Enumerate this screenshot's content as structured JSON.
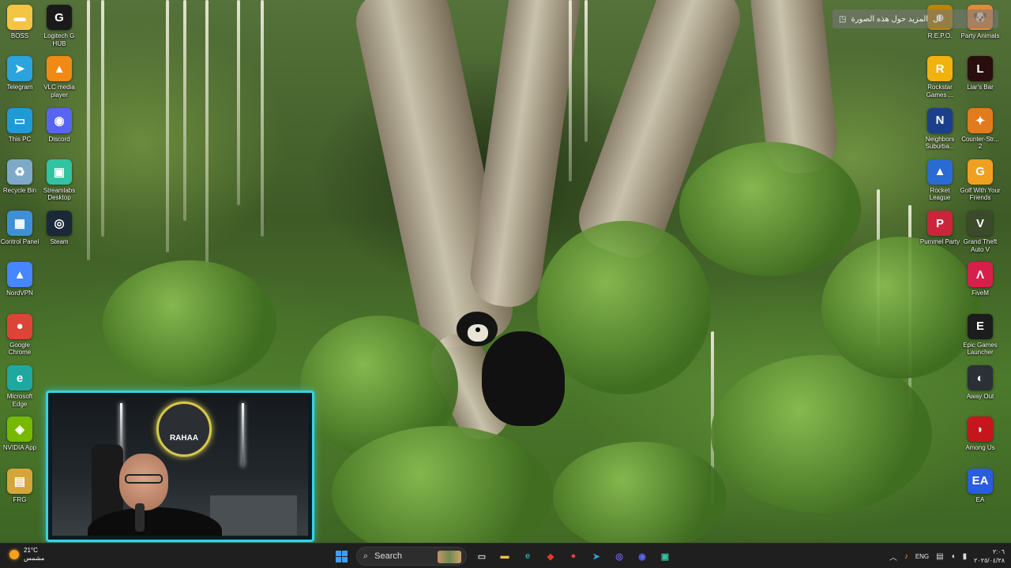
{
  "wallpaper": {
    "subject": "spectacled bear in forest tree"
  },
  "learn_pill": {
    "text": "المزيد حول هذه الصورة",
    "prefix": "ال"
  },
  "desktop_icons_left": [
    {
      "label": "BOSS",
      "icon": "folder-icon",
      "color": "#f4c542",
      "glyph": "▬"
    },
    {
      "label": "Logitech G HUB",
      "icon": "logitech-g-icon",
      "color": "#1a1a1a",
      "glyph": "G"
    },
    {
      "label": "Telegram",
      "icon": "telegram-icon",
      "color": "#2aa3df",
      "glyph": "➤"
    },
    {
      "label": "VLC media player",
      "icon": "vlc-icon",
      "color": "#f08a14",
      "glyph": "▲"
    },
    {
      "label": "This PC",
      "icon": "monitor-icon",
      "color": "#1e9bd7",
      "glyph": "▭"
    },
    {
      "label": "Discord",
      "icon": "discord-icon",
      "color": "#5865f2",
      "glyph": "◉"
    },
    {
      "label": "Recycle Bin",
      "icon": "recycle-bin-icon",
      "color": "#7fa9c9",
      "glyph": "♻"
    },
    {
      "label": "Streamlabs Desktop",
      "icon": "streamlabs-icon",
      "color": "#31c3a2",
      "glyph": "▣"
    },
    {
      "label": "Control Panel",
      "icon": "control-panel-icon",
      "color": "#3f8fd8",
      "glyph": "▦"
    },
    {
      "label": "Steam",
      "icon": "steam-icon",
      "color": "#1b2838",
      "glyph": "◎"
    },
    {
      "label": "NordVPN",
      "icon": "nordvpn-icon",
      "color": "#4687ff",
      "glyph": "▲"
    },
    {
      "label": "",
      "icon": "",
      "color": "",
      "glyph": ""
    },
    {
      "label": "Google Chrome",
      "icon": "chrome-icon",
      "color": "#db4437",
      "glyph": "●"
    },
    {
      "label": "",
      "icon": "",
      "color": "",
      "glyph": ""
    },
    {
      "label": "Microsoft Edge",
      "icon": "edge-icon",
      "color": "#1fa8a0",
      "glyph": "e"
    },
    {
      "label": "",
      "icon": "",
      "color": "",
      "glyph": ""
    },
    {
      "label": "NVIDIA App",
      "icon": "nvidia-icon",
      "color": "#76b900",
      "glyph": "◈"
    },
    {
      "label": "",
      "icon": "",
      "color": "",
      "glyph": ""
    },
    {
      "label": "FRG",
      "icon": "frg-icon",
      "color": "#d2a63a",
      "glyph": "▤"
    }
  ],
  "desktop_icons_right": [
    {
      "label": "R.E.P.O.",
      "icon": "repo-icon",
      "color": "#b8860b",
      "glyph": "☻"
    },
    {
      "label": "Party Animals",
      "icon": "party-animals-icon",
      "color": "#e08a3c",
      "glyph": "🐶"
    },
    {
      "label": "Rockstar Games ...",
      "icon": "rockstar-icon",
      "color": "#f1b210",
      "glyph": "R"
    },
    {
      "label": "Liar's Bar",
      "icon": "liars-bar-icon",
      "color": "#2a0d0d",
      "glyph": "L"
    },
    {
      "label": "Neighbors Suburba...",
      "icon": "neighbors-icon",
      "color": "#1b3f8a",
      "glyph": "N"
    },
    {
      "label": "Counter-Str... 2",
      "icon": "counter-strike-icon",
      "color": "#e27b1d",
      "glyph": "✦"
    },
    {
      "label": "Rocket League",
      "icon": "rocket-league-icon",
      "color": "#2a6bd1",
      "glyph": "▲"
    },
    {
      "label": "Golf With Your Friends",
      "icon": "golf-icon",
      "color": "#f0a020",
      "glyph": "G"
    },
    {
      "label": "Pummel Party",
      "icon": "pummel-party-icon",
      "color": "#c9263b",
      "glyph": "P"
    },
    {
      "label": "Grand Theft Auto V",
      "icon": "gta-icon",
      "color": "#3b4a2a",
      "glyph": "V"
    },
    {
      "label": "",
      "icon": "",
      "color": "",
      "glyph": ""
    },
    {
      "label": "FiveM",
      "icon": "fivem-icon",
      "color": "#d6204b",
      "glyph": "Λ"
    },
    {
      "label": "",
      "icon": "",
      "color": "",
      "glyph": ""
    },
    {
      "label": "Epic Games Launcher",
      "icon": "epic-games-icon",
      "color": "#1c1c1c",
      "glyph": "E"
    },
    {
      "label": "",
      "icon": "",
      "color": "",
      "glyph": ""
    },
    {
      "label": "Away Out",
      "icon": "away-out-icon",
      "color": "#2b2f36",
      "glyph": "◐"
    },
    {
      "label": "",
      "icon": "",
      "color": "",
      "glyph": ""
    },
    {
      "label": "Among Us",
      "icon": "among-us-icon",
      "color": "#c4161c",
      "glyph": "◗"
    },
    {
      "label": "",
      "icon": "",
      "color": "",
      "glyph": ""
    },
    {
      "label": "EA",
      "icon": "ea-icon",
      "color": "#2a5ce0",
      "glyph": "EA"
    }
  ],
  "webcam": {
    "logo_text": "RAHAA"
  },
  "taskbar": {
    "weather": {
      "temp": "21°C",
      "condition": "مشمس"
    },
    "search_placeholder": "Search",
    "pinned": [
      {
        "icon": "task-view-icon",
        "color": "#cfcfcf",
        "glyph": "▭"
      },
      {
        "icon": "file-explorer-icon",
        "color": "#f4c542",
        "glyph": "▬"
      },
      {
        "icon": "edge-icon",
        "color": "#1fa8a0",
        "glyph": "e"
      },
      {
        "icon": "anydesk-icon",
        "color": "#e2382d",
        "glyph": "◆"
      },
      {
        "icon": "chrome-icon",
        "color": "#db4437",
        "glyph": "●"
      },
      {
        "icon": "telegram-icon",
        "color": "#2aa3df",
        "glyph": "➤"
      },
      {
        "icon": "obs-icon",
        "color": "#7c5cff",
        "glyph": "◎"
      },
      {
        "icon": "discord-icon",
        "color": "#5865f2",
        "glyph": "◉"
      },
      {
        "icon": "streamlabs-icon",
        "color": "#31c3a2",
        "glyph": "▣"
      }
    ],
    "tray": {
      "language": "ENG",
      "time": "٢:٠٦",
      "date": "٢٠٢٥/٠٤/٢٨"
    }
  }
}
